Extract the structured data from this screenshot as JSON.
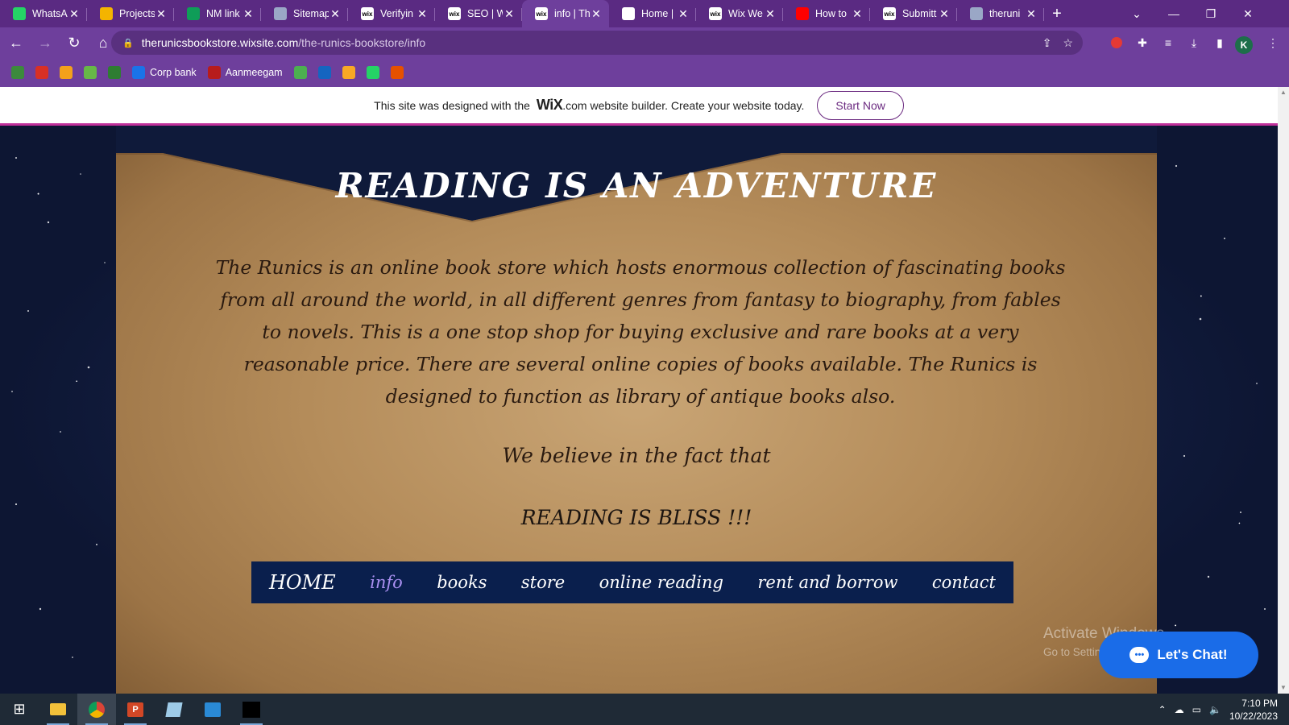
{
  "browser": {
    "tabs": [
      {
        "title": "WhatsA",
        "icon": "whatsapp-icon",
        "color": "#25d366"
      },
      {
        "title": "Projects",
        "icon": "google-drive-icon",
        "color": "#f4b400"
      },
      {
        "title": "NM link",
        "icon": "google-sheets-icon",
        "color": "#0f9d58"
      },
      {
        "title": "Sitemap",
        "icon": "sitemap-icon",
        "color": "#9aa7c6"
      },
      {
        "title": "Verifyin",
        "icon": "wix-icon",
        "color": "#ffffff"
      },
      {
        "title": "SEO | W",
        "icon": "wix-icon",
        "color": "#ffffff"
      },
      {
        "title": "info | Th",
        "icon": "wix-icon",
        "color": "#ffffff",
        "active": true
      },
      {
        "title": "Home |",
        "icon": "globe-icon",
        "color": "#ffffff"
      },
      {
        "title": "Wix We",
        "icon": "wix-icon",
        "color": "#ffffff"
      },
      {
        "title": "How to",
        "icon": "youtube-icon",
        "color": "#ff0000"
      },
      {
        "title": "Submitt",
        "icon": "wix-icon",
        "color": "#ffffff"
      },
      {
        "title": "theruni",
        "icon": "globe-icon",
        "color": "#9aa7c6"
      }
    ],
    "url_host": "therunicsbookstore.wixsite.com",
    "url_path": "/the-runics-bookstore/info",
    "profile_initial": "K",
    "bookmarks": [
      {
        "label": "",
        "icon": "bookmark-green-icon",
        "color": "#3c8a3c"
      },
      {
        "label": "",
        "icon": "gmail-icon",
        "color": "#d93025"
      },
      {
        "label": "",
        "icon": "bookmark-lotus-icon",
        "color": "#f3a11b"
      },
      {
        "label": "",
        "icon": "bookmark-leaf-icon",
        "color": "#67b847"
      },
      {
        "label": "",
        "icon": "bookmark-tree-icon",
        "color": "#2e7d32"
      },
      {
        "label": "Corp bank",
        "icon": "corp-bank-icon",
        "color": "#1a73e8"
      },
      {
        "label": "Aanmeegam",
        "icon": "aanmeegam-icon",
        "color": "#b71c1c"
      },
      {
        "label": "",
        "icon": "bookmark-moon-icon",
        "color": "#4caf50"
      },
      {
        "label": "",
        "icon": "bookmark-y-icon",
        "color": "#1565c0"
      },
      {
        "label": "",
        "icon": "bookmark-photo-icon",
        "color": "#f9a825"
      },
      {
        "label": "",
        "icon": "whatsapp-icon",
        "color": "#25d366"
      },
      {
        "label": "",
        "icon": "bookmark-k-icon",
        "color": "#e65100"
      }
    ]
  },
  "wix_banner": {
    "text_before": "This site was designed with the",
    "logo": "WiX",
    "text_after": ".com website builder. Create your website today.",
    "button": "Start Now"
  },
  "site": {
    "headline": "READING IS AN ADVENTURE",
    "about": "The Runics is an online book store which hosts enormous collection of fascinating books from all around the world, in all different genres from fantasy to biography, from fables to novels. This is a one stop shop for buying exclusive and rare books at a very reasonable price. There are several online copies of books available. The Runics is designed to function as library of antique books also.",
    "believe": "We believe in the fact that",
    "bliss": "READING IS BLISS !!!",
    "nav": [
      {
        "label": "HOME",
        "current": false
      },
      {
        "label": "info",
        "current": true
      },
      {
        "label": "books",
        "current": false
      },
      {
        "label": "store",
        "current": false
      },
      {
        "label": "online reading",
        "current": false
      },
      {
        "label": "rent and borrow",
        "current": false
      },
      {
        "label": "contact",
        "current": false
      }
    ],
    "chat_button": "Let's Chat!"
  },
  "os": {
    "activate_title": "Activate Windows",
    "activate_sub": "Go to Settings to activate Windows.",
    "time": "7:10 PM",
    "date": "10/22/2023"
  },
  "colors": {
    "browser_frame": "#6e3f9c",
    "nav_bg": "#0a1f4d",
    "nav_current": "#a98ff0",
    "chat_button": "#1a6ce8"
  }
}
